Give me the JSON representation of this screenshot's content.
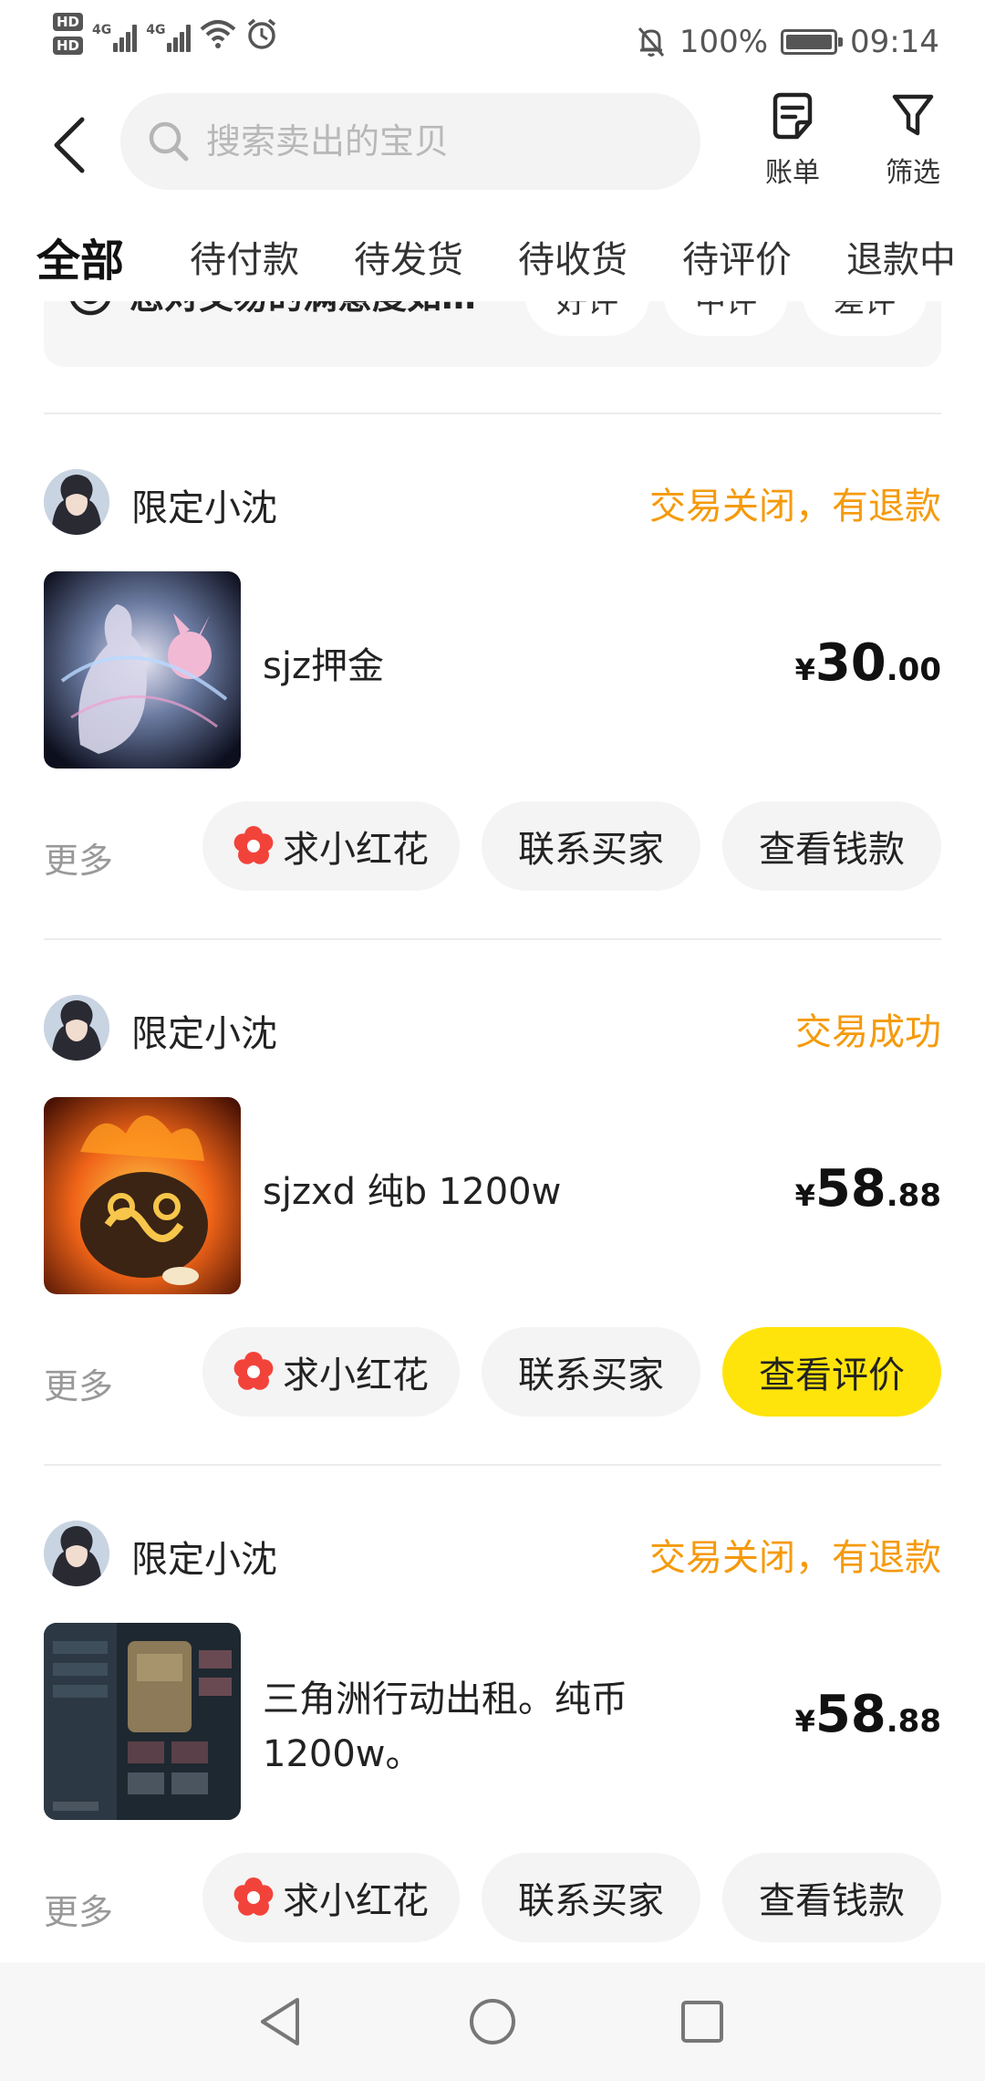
{
  "status_bar": {
    "hd1": "HD",
    "hd2": "HD",
    "net1": "4G",
    "net2": "4G",
    "battery": "100%",
    "time": "09:14",
    "battery_level": 1.0
  },
  "header": {
    "search_placeholder": "搜索卖出的宝贝",
    "bill_label": "账单",
    "filter_label": "筛选"
  },
  "tabs": [
    {
      "label": "全部",
      "active": true
    },
    {
      "label": "待付款"
    },
    {
      "label": "待发货"
    },
    {
      "label": "待收货"
    },
    {
      "label": "待评价"
    },
    {
      "label": "退款中"
    }
  ],
  "feedback": {
    "question": "您对交易的满意度如…",
    "options": [
      "好评",
      "中评",
      "差评"
    ]
  },
  "orders": [
    {
      "seller": "限定小沈",
      "status": "交易关闭，有退款",
      "title": "sjz押金",
      "price_currency": "¥",
      "price_int": "30",
      "price_dec": ".00",
      "more": "更多",
      "btn_flower": "求小红花",
      "btn_contact": "联系买家",
      "btn_view": "查看钱款"
    },
    {
      "seller": "限定小沈",
      "status": "交易成功",
      "title": "sjzxd 纯b 1200w",
      "price_currency": "¥",
      "price_int": "58",
      "price_dec": ".88",
      "more": "更多",
      "btn_flower": "求小红花",
      "btn_contact": "联系买家",
      "btn_view": "查看评价"
    },
    {
      "seller": "限定小沈",
      "status": "交易关闭，有退款",
      "title": "三角洲行动出租。纯币1200w。",
      "price_currency": "¥",
      "price_int": "58",
      "price_dec": ".88",
      "more": "更多",
      "btn_flower": "求小红花",
      "btn_contact": "联系买家",
      "btn_view": "查看钱款"
    }
  ],
  "colors": {
    "accent_yellow": "#ffe40b",
    "status_orange": "#f59a0c",
    "flower_red": "#f2433b"
  }
}
